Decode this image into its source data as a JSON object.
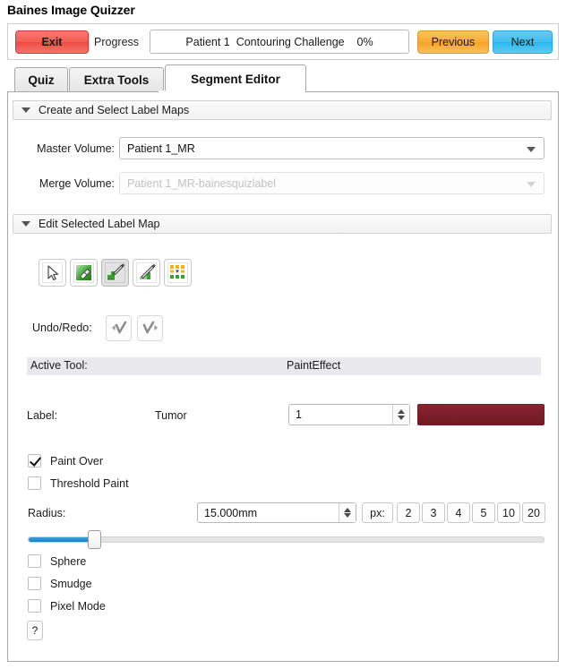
{
  "app": {
    "title": "Baines Image Quizzer"
  },
  "topbar": {
    "exit_label": "Exit",
    "progress_label": "Progress",
    "progress_text": "Patient 1  Contouring Challenge    0%",
    "progress_percent": "0%",
    "previous_label": "Previous",
    "next_label": "Next",
    "exit_color": "#f25b52",
    "previous_color": "#f9ab36",
    "next_color": "#3fc0f0"
  },
  "tabs": [
    {
      "label": "Quiz",
      "active": false
    },
    {
      "label": "Extra Tools",
      "active": false
    },
    {
      "label": "Segment Editor",
      "active": true
    }
  ],
  "sections": {
    "create_select": {
      "title": "Create and Select Label Maps",
      "master_volume_label": "Master Volume:",
      "master_volume_value": "Patient 1_MR",
      "merge_volume_label": "Merge Volume:",
      "merge_volume_value": "Patient 1_MR-bainesquizlabel"
    },
    "edit_label_map": {
      "title": "Edit Selected Label Map"
    }
  },
  "tools": [
    {
      "name": "select-arrow-tool",
      "selected": false
    },
    {
      "name": "erase-label-tool",
      "selected": false
    },
    {
      "name": "paint-effect-tool",
      "selected": true
    },
    {
      "name": "draw-effect-tool",
      "selected": false
    },
    {
      "name": "label-threshold-tool",
      "selected": false
    }
  ],
  "undo_redo": {
    "label": "Undo/Redo:",
    "undo_name": "undo-button",
    "redo_name": "redo-button"
  },
  "active_tool": {
    "label": "Active Tool:",
    "value": "PaintEffect"
  },
  "label_row": {
    "label": "Label:",
    "name": "Tumor",
    "value": "1",
    "color": "#8b2331"
  },
  "options": {
    "paint_over": {
      "label": "Paint Over",
      "checked": true
    },
    "threshold_paint": {
      "label": "Threshold Paint",
      "checked": false
    },
    "sphere": {
      "label": "Sphere",
      "checked": false
    },
    "smudge": {
      "label": "Smudge",
      "checked": false
    },
    "pixel_mode": {
      "label": "Pixel Mode",
      "checked": false
    }
  },
  "radius": {
    "label": "Radius:",
    "value": "15.000mm",
    "px_label": "px:",
    "presets": [
      "2",
      "3",
      "4",
      "5",
      "10",
      "20"
    ],
    "slider_percent": 12
  },
  "help": {
    "label": "?"
  }
}
